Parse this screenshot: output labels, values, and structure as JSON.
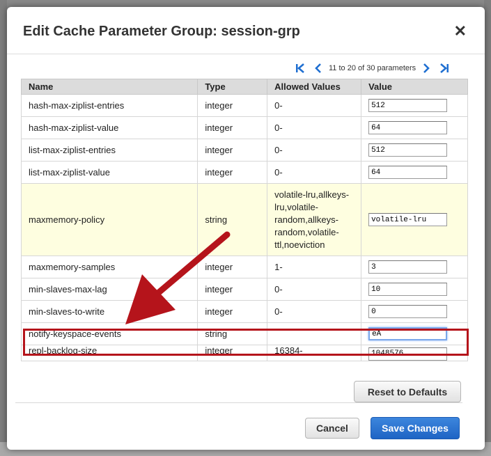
{
  "dialog": {
    "title": "Edit Cache Parameter Group: session-grp",
    "close_label": "✕"
  },
  "pager": {
    "text": "11 to 20 of 30 parameters"
  },
  "table": {
    "headers": {
      "name": "Name",
      "type": "Type",
      "allowed": "Allowed Values",
      "value": "Value"
    },
    "rows": [
      {
        "name": "hash-max-ziplist-entries",
        "type": "integer",
        "allowed": "0-",
        "value": "512"
      },
      {
        "name": "hash-max-ziplist-value",
        "type": "integer",
        "allowed": "0-",
        "value": "64"
      },
      {
        "name": "list-max-ziplist-entries",
        "type": "integer",
        "allowed": "0-",
        "value": "512"
      },
      {
        "name": "list-max-ziplist-value",
        "type": "integer",
        "allowed": "0-",
        "value": "64"
      },
      {
        "name": "maxmemory-policy",
        "type": "string",
        "allowed": "volatile-lru,allkeys-lru,volatile-random,allkeys-random,volatile-ttl,noeviction",
        "allowed_lines": [
          "volatile-lru,allkeys-",
          "lru,volatile-",
          "random,allkeys-",
          "random,volatile-",
          "ttl,noeviction"
        ],
        "value": "volatile-lru"
      },
      {
        "name": "maxmemory-samples",
        "type": "integer",
        "allowed": "1-",
        "value": "3"
      },
      {
        "name": "min-slaves-max-lag",
        "type": "integer",
        "allowed": "0-",
        "value": "10"
      },
      {
        "name": "min-slaves-to-write",
        "type": "integer",
        "allowed": "0-",
        "value": "0"
      },
      {
        "name": "notify-keyspace-events",
        "type": "string",
        "allowed": "",
        "value": "eA"
      },
      {
        "name": "repl-backlog-size",
        "type": "integer",
        "allowed": "16384-",
        "value": "1048576"
      }
    ]
  },
  "buttons": {
    "reset": "Reset to Defaults",
    "cancel": "Cancel",
    "save": "Save Changes"
  },
  "colors": {
    "annotation": "#b5141b",
    "primary": "#1e64c4",
    "highlight_row": "#fefee0"
  }
}
